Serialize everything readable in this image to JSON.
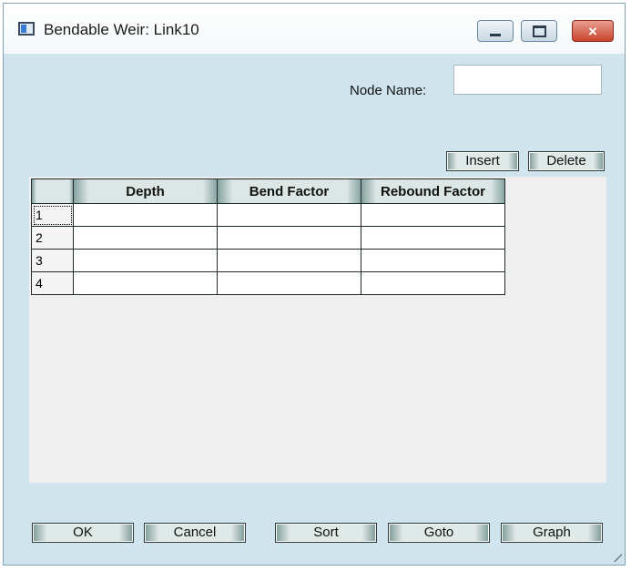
{
  "window": {
    "title": "Bendable Weir: Link10"
  },
  "title_buttons": {
    "minimize": "minimize-icon",
    "maximize": "maximize-icon",
    "close": "×"
  },
  "node": {
    "label": "Node Name:",
    "value": ""
  },
  "grid_buttons": {
    "insert": "Insert",
    "delete": "Delete"
  },
  "table": {
    "columns": [
      "",
      "Depth",
      "Bend Factor",
      "Rebound Factor"
    ],
    "rows": [
      {
        "num": "1",
        "depth": "",
        "bend": "",
        "rebound": ""
      },
      {
        "num": "2",
        "depth": "",
        "bend": "",
        "rebound": ""
      },
      {
        "num": "3",
        "depth": "",
        "bend": "",
        "rebound": ""
      },
      {
        "num": "4",
        "depth": "",
        "bend": "",
        "rebound": ""
      }
    ]
  },
  "footer": {
    "ok": "OK",
    "cancel": "Cancel",
    "sort": "Sort",
    "goto": "Goto",
    "graph": "Graph"
  }
}
